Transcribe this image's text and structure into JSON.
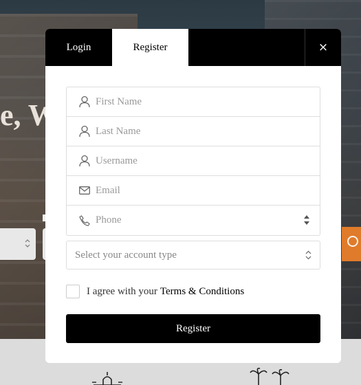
{
  "background": {
    "hero_heading": "e, W",
    "accent_color": "#e07b2b"
  },
  "modal": {
    "tabs": {
      "login": "Login",
      "register": "Register"
    },
    "close_label": "×",
    "fields": {
      "first_name": {
        "placeholder": "First Name",
        "icon": "user-icon"
      },
      "last_name": {
        "placeholder": "Last Name",
        "icon": "user-icon"
      },
      "username": {
        "placeholder": "Username",
        "icon": "user-icon"
      },
      "email": {
        "placeholder": "Email",
        "icon": "envelope-icon"
      },
      "phone": {
        "placeholder": "Phone",
        "icon": "phone-icon"
      }
    },
    "account_type": {
      "selected": "Select your account type"
    },
    "agree": {
      "text": "I agree with your",
      "terms_link": "Terms & Conditions"
    },
    "submit_label": "Register"
  }
}
